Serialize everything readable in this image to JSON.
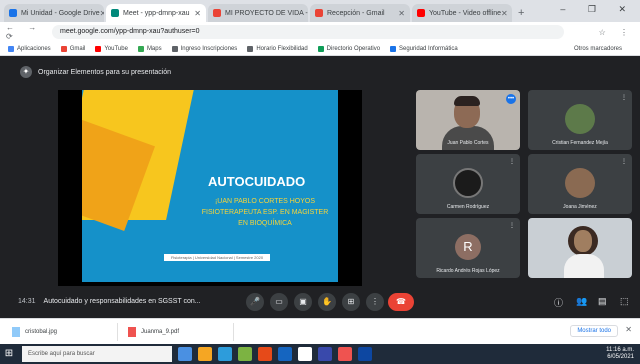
{
  "browser": {
    "tabs": [
      {
        "label": "Mi Unidad - Google Drive",
        "color": "#1a73e8",
        "active": false
      },
      {
        "label": "Meet - ypp-dmnp-xau",
        "color": "#00897b",
        "active": true
      },
      {
        "label": "MI PROYECTO DE VIDA - Do",
        "color": "#ea4335",
        "active": false
      },
      {
        "label": "Recepción - Gmail",
        "color": "#ea4335",
        "active": false
      },
      {
        "label": "YouTube - Video offline",
        "color": "#ff0000",
        "active": false
      }
    ],
    "new_tab": "+",
    "window_controls": "– ❐ ✕",
    "nav_icons": "← → ⟳",
    "url": "meet.google.com/ypp-dmnp-xau?authuser=0",
    "addr_icons": "☆ ⋮",
    "bookmarks": [
      {
        "label": "Aplicaciones",
        "color": "#4285f4"
      },
      {
        "label": "Gmail",
        "color": "#ea4335"
      },
      {
        "label": "YouTube",
        "color": "#ff0000"
      },
      {
        "label": "Maps",
        "color": "#34a853"
      },
      {
        "label": "Ingreso Inscripciones",
        "color": "#5f6368"
      },
      {
        "label": "Horario Flexibilidad",
        "color": "#5f6368"
      },
      {
        "label": "Directorio Operativo",
        "color": "#0f9d58"
      },
      {
        "label": "Seguridad Informática",
        "color": "#1a73e8"
      }
    ],
    "bookmarks_right": "Otros marcadores"
  },
  "meet": {
    "presenting_chip": "Organizar Elementos para su presentación",
    "presenting_icon": "✦",
    "slide": {
      "title": "AUTOCUIDADO",
      "subtitle": "¡UAN PABLO CORTES HOYOS FISIOTERAPEUTA ESP. EN MAGISTER EN BIOQUÍMICA",
      "footer_bar": "Fisioterapia | Universidad Nacional | Semestre 2020"
    },
    "participants": [
      {
        "name": "Juan Pablo Cortes",
        "kind": "video-man",
        "badge": "•••"
      },
      {
        "name": "Cristian Fernandez Mejía",
        "kind": "photo"
      },
      {
        "name": "Carmen Rodríguez",
        "kind": "photo-dark"
      },
      {
        "name": "Joana Jiménez",
        "kind": "photo"
      },
      {
        "name": "Ricardo Andrés Rojas López",
        "kind": "initial",
        "initial": "R"
      },
      {
        "name": "",
        "kind": "video-woman"
      }
    ],
    "mic_icon": "⋮",
    "bottom": {
      "time": "14:31",
      "meeting_title": "Autocuidado y responsabilidades en SGSST con...",
      "buttons": [
        "🎤",
        "▭",
        "▣",
        "✋",
        "⊞",
        "⋮"
      ],
      "end_icon": "☎",
      "right_icons": [
        "ⓘ",
        "👥",
        "▤",
        "⬚"
      ]
    }
  },
  "downloads": {
    "items": [
      {
        "label": "cristobal.jpg",
        "color": "#90caf9"
      },
      {
        "label": "Juanma_9.pdf",
        "color": "#ef5350"
      }
    ],
    "show_all": "Mostrar todo",
    "close": "✕"
  },
  "taskbar": {
    "start": "⊞",
    "search": "Escribe aquí para buscar",
    "apps": [
      "#4a90e2",
      "#f5a623",
      "#2d9cdb",
      "#7cb342",
      "#e64a19",
      "#1565c0",
      "#ffffff",
      "#3949ab",
      "#ef5350",
      "#0d47a1"
    ],
    "time": "11:16 a.m.",
    "date": "6/05/2021"
  }
}
